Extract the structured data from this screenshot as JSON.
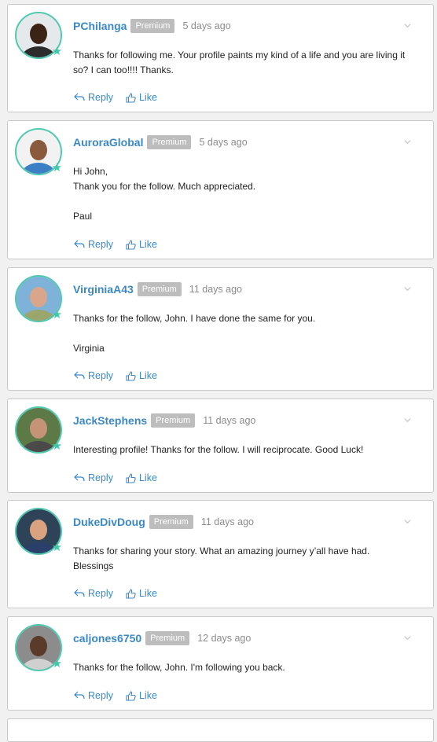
{
  "comments": [
    {
      "username": "PChilanga",
      "badge": "Premium",
      "time": "5 days ago",
      "lines": [
        "Thanks for following me. Your profile paints my kind of a life and you are living it",
        "so? I can too!!!! Thanks."
      ],
      "reply_label": "Reply",
      "like_label": "Like",
      "avatar": {
        "bg": "#e6e9ec",
        "face": "#3b2416",
        "shirt": "#2c2c2c"
      }
    },
    {
      "username": "AuroraGlobal",
      "badge": "Premium",
      "time": "5 days ago",
      "lines": [
        "Hi John,",
        "Thank you for the follow. Much appreciated.",
        "",
        "Paul"
      ],
      "reply_label": "Reply",
      "like_label": "Like",
      "avatar": {
        "bg": "#f2f2f2",
        "face": "#8a5a3c",
        "shirt": "#3d7fc4"
      }
    },
    {
      "username": "VirginiaA43",
      "badge": "Premium",
      "time": "11 days ago",
      "lines": [
        "Thanks for the follow, John. I have done the same for you.",
        "",
        "Virginia"
      ],
      "reply_label": "Reply",
      "like_label": "Like",
      "avatar": {
        "bg": "#7fb2d9",
        "face": "#d9a58b",
        "shirt": "#9aa66b"
      }
    },
    {
      "username": "JackStephens",
      "badge": "Premium",
      "time": "11 days ago",
      "lines": [
        "Interesting profile! Thanks for the follow. I will reciprocate. Good Luck!"
      ],
      "reply_label": "Reply",
      "like_label": "Like",
      "avatar": {
        "bg": "#5d7a46",
        "face": "#c59378",
        "shirt": "#4a4a4a"
      }
    },
    {
      "username": "DukeDivDoug",
      "badge": "Premium",
      "time": "11 days ago",
      "lines": [
        "Thanks for sharing your story. What an amazing journey y’all have had.",
        "Blessings"
      ],
      "reply_label": "Reply",
      "like_label": "Like",
      "avatar": {
        "bg": "#2f4358",
        "face": "#d9a380",
        "shirt": "#2a3f6a"
      }
    },
    {
      "username": "caljones6750",
      "badge": "Premium",
      "time": "12 days ago",
      "lines": [
        "Thanks for the follow, John. I'm following you back."
      ],
      "reply_label": "Reply",
      "like_label": "Like",
      "avatar": {
        "bg": "#8c8c8c",
        "face": "#5a3a28",
        "shirt": "#d0d0d0"
      }
    }
  ]
}
